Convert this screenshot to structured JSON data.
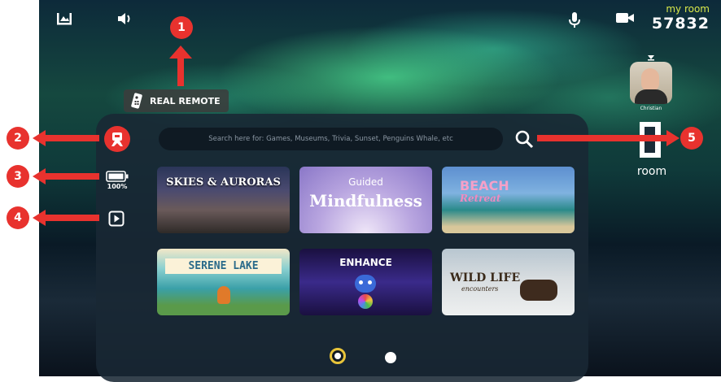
{
  "room": {
    "label": "my room",
    "code": "57832",
    "exit_label": "room"
  },
  "user": {
    "name": "Christian"
  },
  "remote": {
    "label": "REAL REMOTE"
  },
  "search": {
    "placeholder": "Search here for: Games, Museums, Trivia, Sunset, Penguins Whale, etc"
  },
  "battery": {
    "level": "100%"
  },
  "tiles": [
    {
      "title": "SKIES & AURORAS"
    },
    {
      "title_small": "Guided",
      "title": "Mindfulness"
    },
    {
      "title": "BEACH",
      "subtitle": "Retreat"
    },
    {
      "title": "SERENE LAKE"
    },
    {
      "title": "ENHANCE"
    },
    {
      "title": "WILD LIFE",
      "subtitle": "encounters"
    }
  ],
  "callouts": [
    "1",
    "2",
    "3",
    "4",
    "5"
  ],
  "pagination": {
    "current": 1,
    "total": 2
  },
  "icons": {
    "top": [
      "picture-icon",
      "volume-icon",
      "microphone-icon",
      "video-camera-icon"
    ],
    "side": [
      "avatar-logo-icon",
      "battery-icon",
      "play-icon"
    ],
    "search": "search-icon",
    "remote": "remote-icon"
  },
  "colors": {
    "callout": "#e8322e",
    "accent": "#d9e84a",
    "panel": "#19283a"
  }
}
